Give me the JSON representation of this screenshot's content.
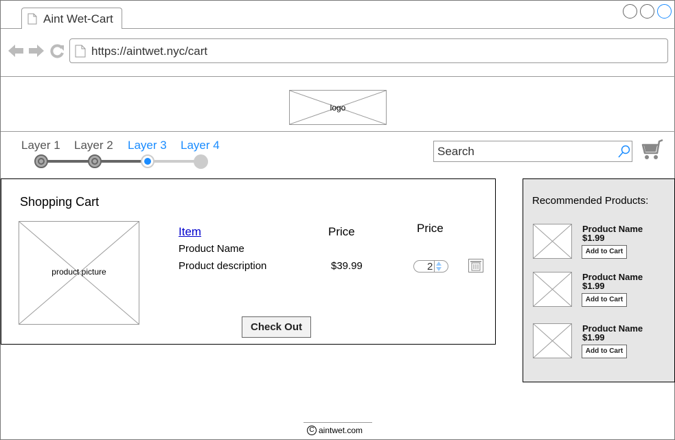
{
  "browser": {
    "tab_title": "Aint Wet-Cart",
    "url": "https://aintwet.nyc/cart"
  },
  "header": {
    "logo_label": "logo"
  },
  "steps": [
    {
      "label": "Layer 1",
      "state": "done"
    },
    {
      "label": "Layer 2",
      "state": "done"
    },
    {
      "label": "Layer 3",
      "state": "current"
    },
    {
      "label": "Layer 4",
      "state": "todo"
    }
  ],
  "search": {
    "placeholder": "Search"
  },
  "cart": {
    "title": "Shopping Cart",
    "picture_label": "product picture",
    "columns": {
      "item": "Item",
      "price": "Price",
      "quantity": "Price"
    },
    "product_name": "Product Name",
    "product_description": "Product description",
    "product_price": "$39.99",
    "quantity": "2",
    "checkout_label": "Check Out"
  },
  "recommended": {
    "title": "Recommended Products:",
    "items": [
      {
        "name": "Product Name",
        "price": "$1.99",
        "button": "Add to Cart"
      },
      {
        "name": "Product Name",
        "price": "$1.99",
        "button": "Add to Cart"
      },
      {
        "name": "Product Name",
        "price": "$1.99",
        "button": "Add to Cart"
      }
    ]
  },
  "footer": {
    "text": "aintwet.com"
  },
  "colors": {
    "link": "#0000cc",
    "active_step": "#1a8cff",
    "panel_gray": "#e6e6e6"
  }
}
